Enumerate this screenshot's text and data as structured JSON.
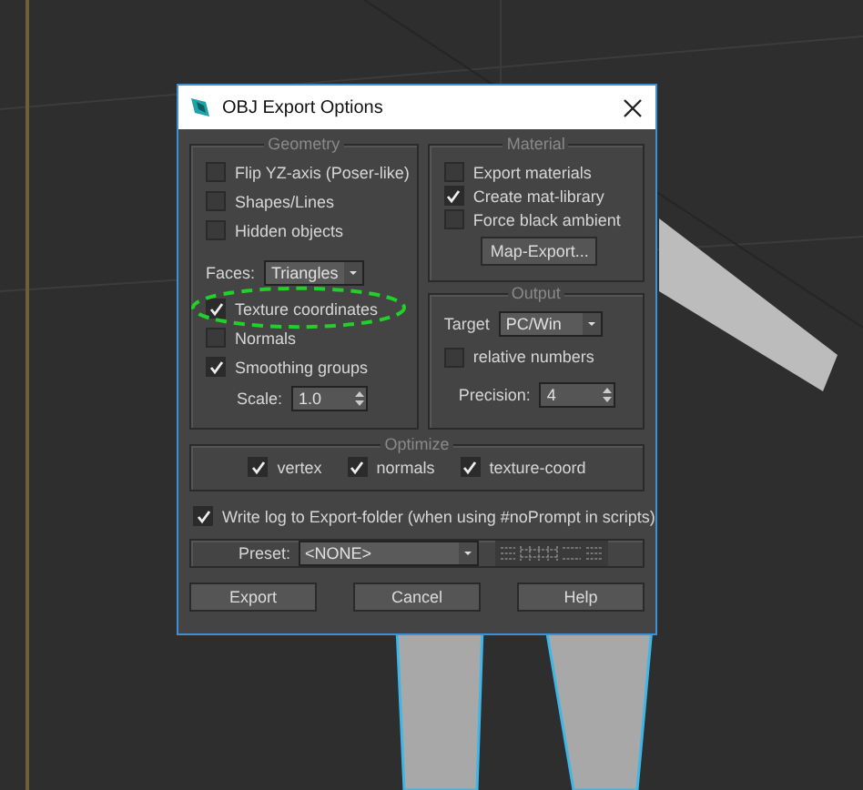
{
  "window": {
    "title": "OBJ Export Options"
  },
  "geometry": {
    "title": "Geometry",
    "options": [
      {
        "label": "Flip YZ-axis (Poser-like)",
        "checked": false
      },
      {
        "label": "Shapes/Lines",
        "checked": false
      },
      {
        "label": "Hidden objects",
        "checked": false
      }
    ],
    "faces": {
      "label": "Faces:",
      "value": "Triangles"
    },
    "options2": [
      {
        "label": "Texture coordinates",
        "checked": true
      },
      {
        "label": "Normals",
        "checked": false
      },
      {
        "label": "Smoothing groups",
        "checked": true
      }
    ],
    "scale": {
      "label": "Scale:",
      "value": "1.0"
    }
  },
  "material": {
    "title": "Material",
    "options": [
      {
        "label": "Export materials",
        "checked": false
      },
      {
        "label": "Create mat-library",
        "checked": true
      },
      {
        "label": "Force black ambient",
        "checked": false
      }
    ],
    "button": "Map-Export..."
  },
  "output": {
    "title": "Output",
    "target": {
      "label": "Target",
      "value": "PC/Win"
    },
    "options": [
      {
        "label": "relative numbers",
        "checked": false
      }
    ],
    "precision": {
      "label": "Precision:",
      "value": "4"
    }
  },
  "optimize": {
    "title": "Optimize",
    "options": [
      {
        "label": "vertex",
        "checked": true
      },
      {
        "label": "normals",
        "checked": true
      },
      {
        "label": "texture-coord",
        "checked": true
      }
    ]
  },
  "log": {
    "label": "Write log to Export-folder (when using #noPrompt in scripts)",
    "checked": true
  },
  "preset": {
    "label": "Preset:",
    "value": "<NONE>"
  },
  "buttons": [
    "Export",
    "Cancel",
    "Help"
  ]
}
